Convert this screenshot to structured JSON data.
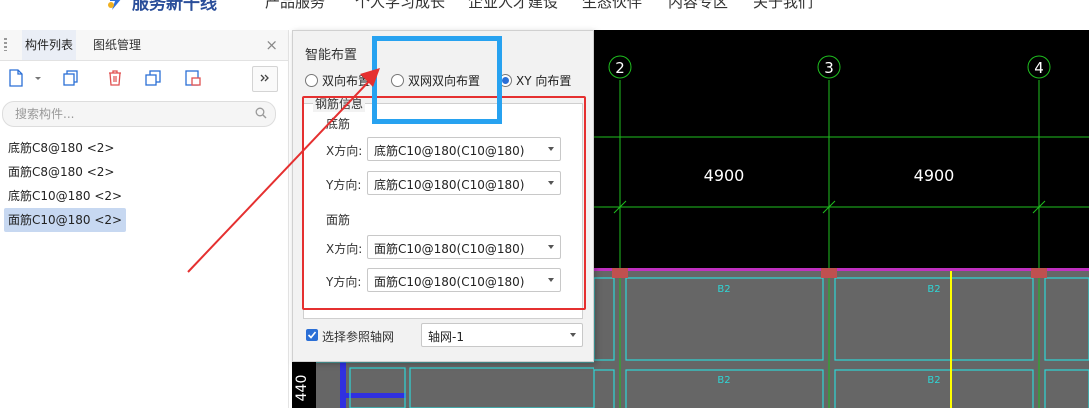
{
  "nav": {
    "logo_text": "服务新干线",
    "items": [
      "产品服务",
      "个人学习成长",
      "企业人才建设",
      "生态伙伴",
      "内容专区",
      "关于我们"
    ]
  },
  "left_panel": {
    "tabs": [
      "构件列表",
      "图纸管理"
    ],
    "search_placeholder": "搜索构件...",
    "items": [
      "底筋C8@180 <2>",
      "面筋C8@180 <2>",
      "底筋C10@180 <2>",
      "面筋C10@180 <2>"
    ],
    "selected_index": 3
  },
  "dialog": {
    "title": "智能布置",
    "radios": [
      {
        "label": "双向布置",
        "checked": false
      },
      {
        "label": "双网双向布置",
        "checked": false
      },
      {
        "label": "XY 向布置",
        "checked": true
      }
    ],
    "group_title": "钢筋信息",
    "bottom": {
      "title": "底筋",
      "x_label": "X方向:",
      "x_value": "底筋C10@180(C10@180)",
      "y_label": "Y方向:",
      "y_value": "底筋C10@180(C10@180)"
    },
    "top": {
      "title": "面筋",
      "x_label": "X方向:",
      "x_value": "面筋C10@180(C10@180)",
      "y_label": "Y方向:",
      "y_value": "面筋C10@180(C10@180)"
    },
    "ref_axis_label": "选择参照轴网",
    "ref_axis_checked": true,
    "ref_axis_value": "轴网-1"
  },
  "canvas": {
    "axis_labels": [
      "2",
      "3",
      "4"
    ],
    "dimensions": [
      "4900",
      "4900"
    ],
    "left_dimension": "440",
    "slab_label": "B2",
    "colors": {
      "grid": "#1fbf1f",
      "slab": "#666666",
      "beam": "#2fd6d6",
      "highlight": "#ffff00",
      "accent_red": "#e53030",
      "accent_blue": "#27a2f0"
    }
  }
}
